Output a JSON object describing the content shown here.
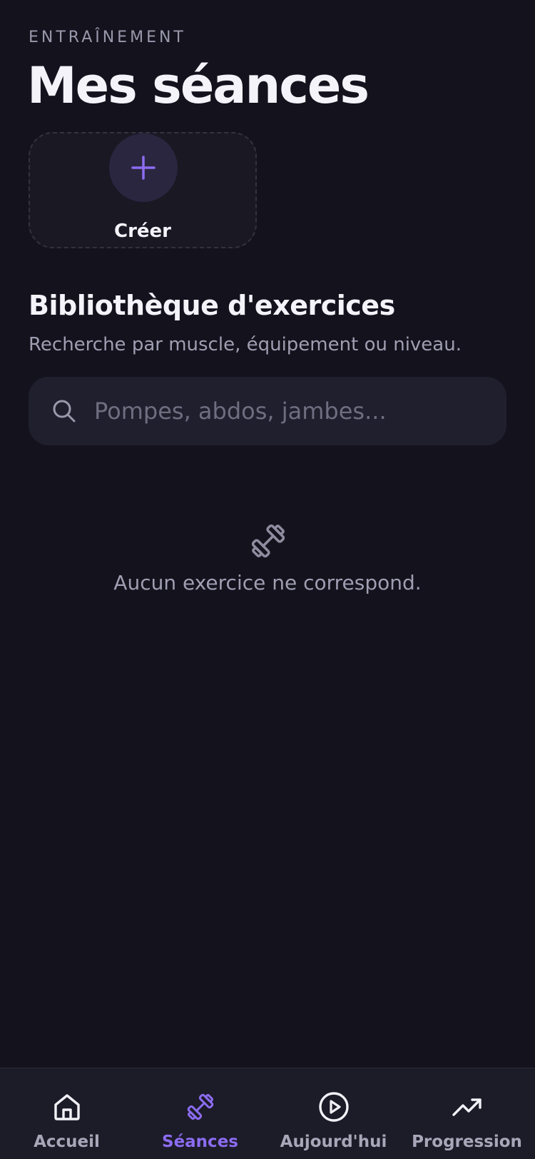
{
  "header": {
    "eyebrow": "ENTRAÎNEMENT",
    "title": "Mes séances"
  },
  "create_card": {
    "label": "Créer",
    "icon": "plus-icon"
  },
  "library": {
    "title": "Bibliothèque d'exercices",
    "subtitle": "Recherche par muscle, équipement ou niveau.",
    "search": {
      "placeholder": "Pompes, abdos, jambes...",
      "value": ""
    },
    "empty_state": {
      "icon": "dumbbell-icon",
      "text": "Aucun exercice ne correspond."
    }
  },
  "tabbar": {
    "items": [
      {
        "label": "Accueil",
        "icon": "home-icon",
        "active": false
      },
      {
        "label": "Séances",
        "icon": "dumbbell-icon",
        "active": true
      },
      {
        "label": "Aujourd'hui",
        "icon": "play-circle-icon",
        "active": false
      },
      {
        "label": "Progression",
        "icon": "trending-up-icon",
        "active": false
      }
    ]
  },
  "colors": {
    "background": "#13121d",
    "accent": "#8b6cf0",
    "surface": "#201f2d",
    "muted_text": "#a09eb1"
  }
}
